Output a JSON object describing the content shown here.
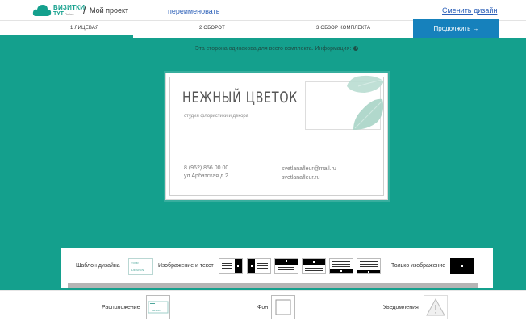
{
  "header": {
    "logo_line1": "ВИЗИТКИ",
    "logo_line2": "ТУТ",
    "logo_line3": "Online",
    "separator": "/",
    "project_name": "Мой проект",
    "rename_link": "переименовать",
    "change_design_link": "Сменить дизайн"
  },
  "steps": [
    {
      "label": "1 ЛИЦЕВАЯ",
      "active": true
    },
    {
      "label": "2 ОБОРОТ",
      "active": false
    },
    {
      "label": "3 ОБЗОР КОМПЛЕКТА",
      "active": false
    }
  ],
  "continue_button": "Продолжить →",
  "info_text": "Эта сторона одинакова для всего комплекта. Информация:",
  "info_icon": "i",
  "card": {
    "title": "НЕЖНЫЙ ЦВЕТОК",
    "subtitle": "студия флористики и декора",
    "phone": "8 (962) 856 00 00",
    "address": "ул.Арбатская  д.2",
    "email": "svetlanafleur@mail.ru",
    "site": "svetlanafleur.ru"
  },
  "template_panel": {
    "design_label": "Шаблон дизайна",
    "design_thumb_top": "YOUR",
    "design_thumb_text": "DESIGN",
    "image_text_label": "Изображение и текст",
    "image_only_label": "Только изображение"
  },
  "bottom_bar": {
    "layout_label": "Расположение",
    "layout_thumb_text": "DESIGN",
    "background_label": "Фон",
    "notifications_label": "Уведомления"
  },
  "colors": {
    "teal": "#14a08d",
    "blue": "#1681bc",
    "link": "#2b5fb8"
  }
}
